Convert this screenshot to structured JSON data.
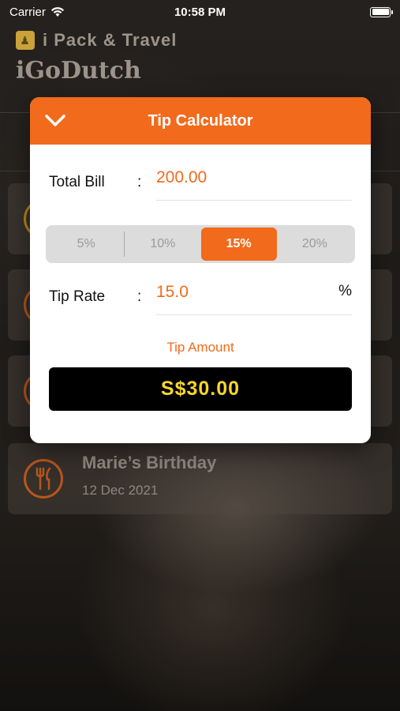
{
  "status_bar": {
    "carrier": "Carrier",
    "time": "10:58 PM"
  },
  "header": {
    "brand_name": "i Pack & Travel",
    "app_title": "iGoDutch"
  },
  "background_events": [
    {
      "title": "Marie’s Birthday",
      "date": "12 Dec 2021"
    }
  ],
  "modal": {
    "title": "Tip Calculator",
    "total_bill_label": "Total Bill",
    "colon": ":",
    "total_bill_value": "200.00",
    "tip_options": [
      "5%",
      "10%",
      "15%",
      "20%"
    ],
    "selected_tip_index": 2,
    "tip_rate_label": "Tip Rate",
    "tip_rate_value": "15.0",
    "tip_rate_unit": "%",
    "tip_amount_label": "Tip Amount",
    "tip_amount_value": "S$30.00"
  },
  "colors": {
    "accent": "#f26a1b",
    "tip_value": "#f8d728"
  }
}
